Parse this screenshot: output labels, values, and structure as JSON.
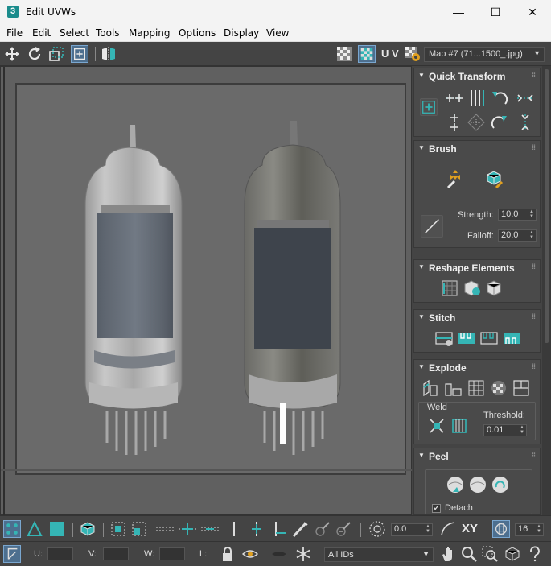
{
  "window": {
    "app_icon": "3",
    "title": "Edit UVWs",
    "minimize": "—",
    "maximize": "☐",
    "close": "✕"
  },
  "menu": [
    "File",
    "Edit",
    "Select",
    "Tools",
    "Mapping",
    "Options",
    "Display",
    "View"
  ],
  "toolbar": {
    "uv_label": "U V",
    "map_select": "Map #7 (71...1500_.jpg)"
  },
  "panel": {
    "quick_transform": {
      "title": "Quick Transform"
    },
    "brush": {
      "title": "Brush",
      "strength_label": "Strength:",
      "strength_value": "10.0",
      "falloff_label": "Falloff:",
      "falloff_value": "20.0"
    },
    "reshape": {
      "title": "Reshape Elements"
    },
    "stitch": {
      "title": "Stitch"
    },
    "explode": {
      "title": "Explode",
      "weld_label": "Weld",
      "threshold_label": "Threshold:",
      "threshold_value": "0.01"
    },
    "peel": {
      "title": "Peel",
      "detach_label": "Detach",
      "detach_checked": true
    }
  },
  "bottom": {
    "offset_value": "0.0",
    "xy_label": "XY",
    "grid_value": "16",
    "u_label": "U:",
    "v_label": "V:",
    "w_label": "W:",
    "l_label": "L:",
    "ids_select": "All IDs"
  },
  "colors": {
    "accent_teal": "#35b5b5",
    "panel_bg": "#444444",
    "viewport_bg": "#6a6a6a"
  }
}
